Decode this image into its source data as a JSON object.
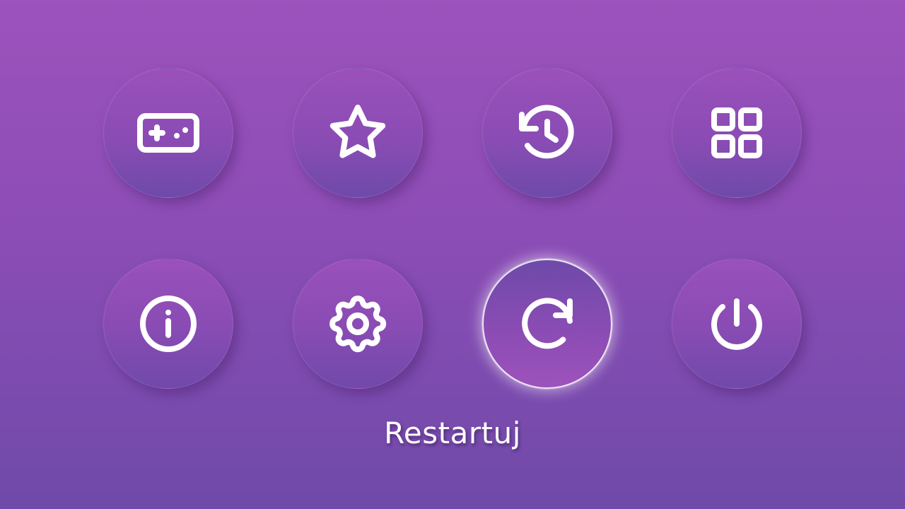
{
  "menu": {
    "selected_label": "Restartuj",
    "items": [
      {
        "id": "games",
        "icon": "gamepad-icon"
      },
      {
        "id": "favorites",
        "icon": "star-icon"
      },
      {
        "id": "history",
        "icon": "history-icon"
      },
      {
        "id": "apps",
        "icon": "grid-icon"
      },
      {
        "id": "info",
        "icon": "info-icon"
      },
      {
        "id": "settings",
        "icon": "gear-icon"
      },
      {
        "id": "restart",
        "icon": "restart-icon",
        "selected": true
      },
      {
        "id": "power",
        "icon": "power-icon"
      }
    ]
  },
  "colors": {
    "background_top": "#9d52bc",
    "background_bottom": "#6f4aa9",
    "icon": "#ffffff",
    "highlight": "#ffffff"
  }
}
